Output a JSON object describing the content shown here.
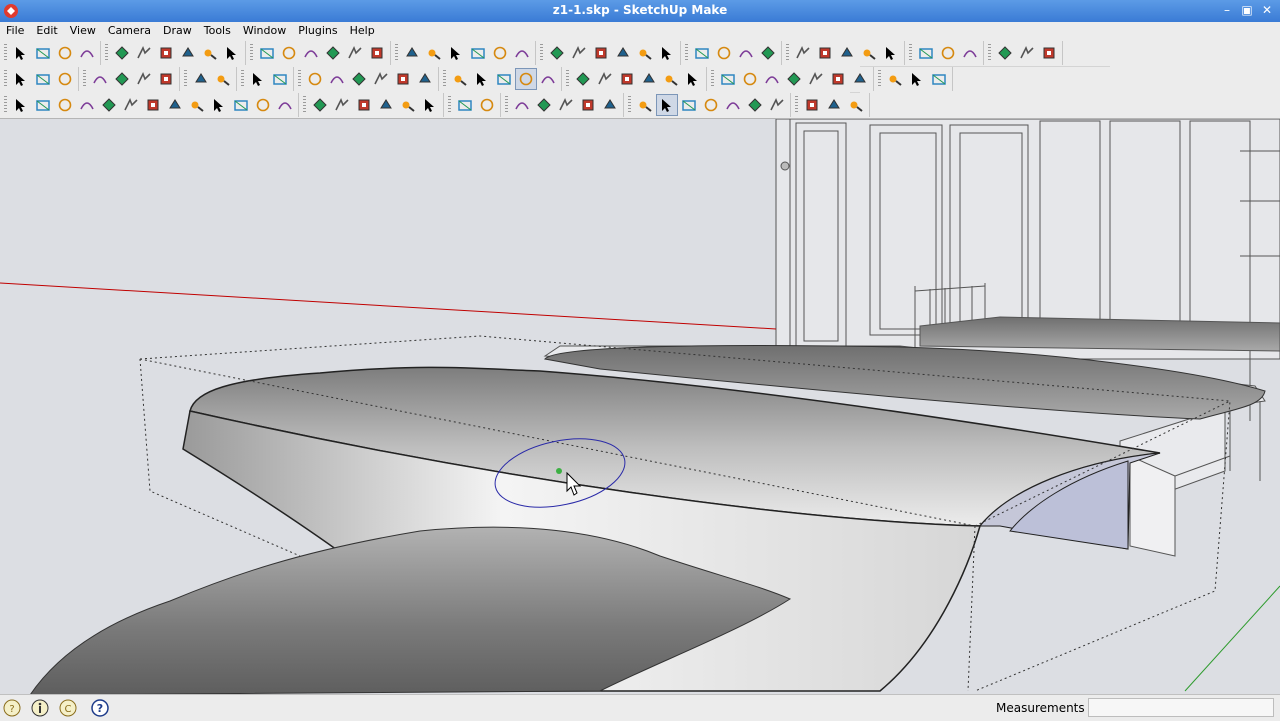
{
  "window": {
    "title": "z1-1.skp - SketchUp Make"
  },
  "menu": [
    "File",
    "Edit",
    "View",
    "Camera",
    "Draw",
    "Tools",
    "Window",
    "Plugins",
    "Help"
  ],
  "toolbar": {
    "row1": [
      [
        "select-icon",
        "component-icon",
        "paint-bucket-icon",
        "eraser-icon"
      ],
      [
        "rectangle-icon",
        "line-icon",
        "circle-icon",
        "arc-icon",
        "polygon-icon",
        "freehand-icon"
      ],
      [
        "move-icon",
        "push-pull-icon",
        "rotate-icon",
        "follow-me-icon",
        "scale-icon",
        "offset-icon"
      ],
      [
        "tape-measure-icon",
        "dimension-icon",
        "protractor-icon",
        "text-icon",
        "axes-icon",
        "3d-text-icon"
      ],
      [
        "orbit-icon",
        "pan-icon",
        "zoom-icon",
        "zoom-window-icon",
        "zoom-extents-icon",
        "previous-view-icon"
      ],
      [
        "position-camera-icon",
        "look-around-icon",
        "walk-icon",
        "section-plane-icon"
      ],
      [
        "sandbox-icon-1",
        "sandbox-icon-2",
        "sandbox-icon-3",
        "sandbox-icon-4",
        "sandbox-icon-5"
      ],
      [
        "undo-icon",
        "redo-icon",
        "paint-icon"
      ],
      [
        "warehouse-icon",
        "components-icon",
        "styles-icon"
      ]
    ],
    "row2": [
      [
        "new-icon",
        "open-icon",
        "save-icon"
      ],
      [
        "cut-icon",
        "copy-icon",
        "paste-icon",
        "erase-icon"
      ],
      [
        "undo-arrow-icon",
        "redo-arrow-icon"
      ],
      [
        "print-icon",
        "model-info-icon"
      ],
      [
        "iso-view-icon",
        "top-view-icon",
        "front-view-icon",
        "right-view-icon",
        "back-view-icon",
        "left-view-icon"
      ],
      [
        "xray-icon",
        "wireframe-icon",
        "hidden-line-icon",
        "shaded-icon",
        "shaded-textures-icon"
      ],
      [
        "house-icon-1",
        "house-icon-2",
        "house-icon-3",
        "house-icon-4",
        "house-icon-5",
        "house-icon-6"
      ],
      [
        "solid-tool-icon-1",
        "solid-tool-icon-2",
        "solid-tool-icon-3",
        "solid-tool-icon-4",
        "solid-tool-icon-5",
        "solid-tool-icon-6",
        "solid-tool-icon-7"
      ],
      [
        "cube-icon-1",
        "cube-icon-2",
        "cube-icon-3"
      ]
    ],
    "row3": [
      [
        "curve-icon-1",
        "curve-icon-2",
        "curve-icon-3",
        "curve-icon-4",
        "curve-icon-5",
        "curve-icon-6",
        "curve-icon-7",
        "curve-icon-8",
        "curve-icon-9",
        "curve-icon-10",
        "curve-icon-11",
        "curve-icon-12",
        "curve-icon-13"
      ],
      [
        "curve-icon-14",
        "curve-icon-15",
        "curve-icon-16",
        "curve-icon-17",
        "curve-icon-18",
        "curve-icon-19"
      ],
      [
        "face-tool-icon-1",
        "face-tool-icon-2"
      ],
      [
        "mesh-icon-1",
        "mesh-icon-2",
        "mesh-icon-3",
        "mesh-icon-4",
        "mesh-icon-5"
      ],
      [
        "render-icon-1",
        "render-icon-2",
        "render-icon-3",
        "render-icon-4",
        "render-icon-5",
        "render-icon-6",
        "render-icon-7"
      ],
      [
        "plugin-icon-1",
        "plugin-icon-2",
        "plugin-icon-3"
      ]
    ]
  },
  "status": {
    "icons": [
      "geo-location-icon",
      "info-icon",
      "credits-icon",
      "help-icon"
    ],
    "measurements_label": "Measurements",
    "measurements_value": ""
  }
}
